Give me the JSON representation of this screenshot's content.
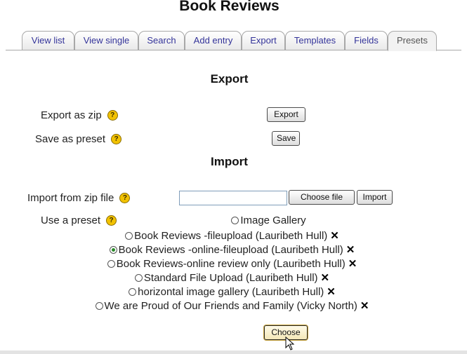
{
  "page": {
    "title": "Book Reviews"
  },
  "tabs": [
    {
      "label": "View list"
    },
    {
      "label": "View single"
    },
    {
      "label": "Search"
    },
    {
      "label": "Add entry"
    },
    {
      "label": "Export"
    },
    {
      "label": "Templates"
    },
    {
      "label": "Fields"
    },
    {
      "label": "Presets",
      "active": true
    }
  ],
  "export": {
    "title": "Export",
    "zip_label": "Export as zip",
    "zip_button": "Export",
    "preset_label": "Save as preset",
    "preset_button": "Save"
  },
  "import": {
    "title": "Import",
    "zip_label": "Import from zip file",
    "choose_file_button": "Choose file",
    "import_button": "Import",
    "preset_label": "Use a preset",
    "presets": [
      {
        "label": "Image Gallery",
        "selected": false,
        "deletable": false
      },
      {
        "label": "Book Reviews -fileupload (Lauribeth Hull)",
        "selected": false,
        "deletable": true
      },
      {
        "label": "Book Reviews -online-fileupload (Lauribeth Hull)",
        "selected": true,
        "deletable": true
      },
      {
        "label": "Book Reviews-online review only (Lauribeth Hull)",
        "selected": false,
        "deletable": true
      },
      {
        "label": "Standard File Upload (Lauribeth Hull)",
        "selected": false,
        "deletable": true
      },
      {
        "label": "horizontal image gallery (Lauribeth Hull)",
        "selected": false,
        "deletable": true
      },
      {
        "label": "We are Proud of Our Friends and Family (Vicky North)",
        "selected": false,
        "deletable": true
      }
    ],
    "choose_button": "Choose"
  },
  "icons": {
    "help": "?",
    "delete": "✕"
  },
  "colors": {
    "tab_text": "#333399",
    "help_icon": "#f2c200",
    "radio_selected": "#2a8a2a"
  }
}
